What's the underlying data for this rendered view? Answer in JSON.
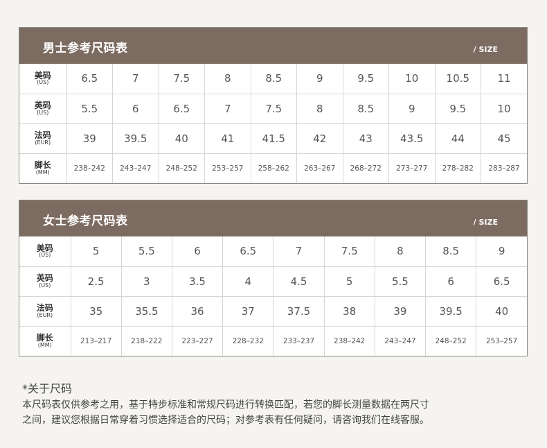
{
  "men": {
    "title": "男士参考尺码表",
    "size_tag": "/ SIZE",
    "rows": [
      {
        "zh": "美码",
        "en": "(US)",
        "values": [
          "6.5",
          "7",
          "7.5",
          "8",
          "8.5",
          "9",
          "9.5",
          "10",
          "10.5",
          "11"
        ]
      },
      {
        "zh": "英码",
        "en": "(US)",
        "values": [
          "5.5",
          "6",
          "6.5",
          "7",
          "7.5",
          "8",
          "8.5",
          "9",
          "9.5",
          "10"
        ]
      },
      {
        "zh": "法码",
        "en": "(EUR)",
        "values": [
          "39",
          "39.5",
          "40",
          "41",
          "41.5",
          "42",
          "43",
          "43.5",
          "44",
          "45"
        ]
      },
      {
        "zh": "脚长",
        "en": "(MM)",
        "values": [
          "238–242",
          "243–247",
          "248–252",
          "253–257",
          "258–262",
          "263–267",
          "268–272",
          "273–277",
          "278–282",
          "283–287"
        ]
      }
    ]
  },
  "women": {
    "title": "女士参考尺码表",
    "size_tag": "/ SIZE",
    "rows": [
      {
        "zh": "美码",
        "en": "(US)",
        "values": [
          "5",
          "5.5",
          "6",
          "6.5",
          "7",
          "7.5",
          "8",
          "8.5",
          "9"
        ]
      },
      {
        "zh": "英码",
        "en": "(US)",
        "values": [
          "2.5",
          "3",
          "3.5",
          "4",
          "4.5",
          "5",
          "5.5",
          "6",
          "6.5"
        ]
      },
      {
        "zh": "法码",
        "en": "(EUR)",
        "values": [
          "35",
          "35.5",
          "36",
          "37",
          "37.5",
          "38",
          "39",
          "39.5",
          "40"
        ]
      },
      {
        "zh": "脚长",
        "en": "(MM)",
        "values": [
          "213–217",
          "218–222",
          "223–227",
          "228–232",
          "233–237",
          "238–242",
          "243–247",
          "248–252",
          "253–257"
        ]
      }
    ]
  },
  "note": {
    "title": "*关于尺码",
    "line1": "本尺码表仅供参考之用，基于特步标准和常规尺码进行转换匹配，若您的脚长测量数据在两尺寸",
    "line2": "之间，建议您根据日常穿着习惯选择适合的尺码；对参考表有任何疑问，请咨询我们在线客服。"
  }
}
